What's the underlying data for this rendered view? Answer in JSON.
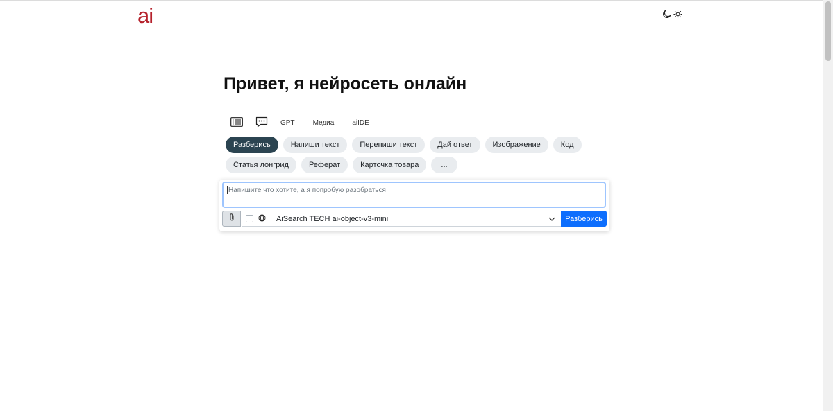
{
  "header": {
    "logo_text": "ai",
    "logo_color": "#b5212b",
    "theme_icons": [
      "moon-icon",
      "sun-icon"
    ]
  },
  "main": {
    "title": "Привет, я нейросеть онлайн",
    "mode_tabs": [
      {
        "icon": "list-icon"
      },
      {
        "icon": "chat-bubble-icon"
      },
      {
        "label": "GPT"
      },
      {
        "label": "Медиа"
      },
      {
        "label": "aiIDE"
      }
    ],
    "prompt_chips": [
      {
        "label": "Разберись",
        "active": true
      },
      {
        "label": "Напиши текст"
      },
      {
        "label": "Перепиши текст"
      },
      {
        "label": "Дай ответ"
      },
      {
        "label": "Изображение"
      },
      {
        "label": "Код"
      },
      {
        "label": "Статья лонгрид"
      },
      {
        "label": "Реферат"
      },
      {
        "label": "Карточка товара"
      },
      {
        "label": "..."
      }
    ],
    "composer": {
      "placeholder": "Напишите что хотите, а я попробую разобраться",
      "value": "",
      "attach_icon": "paperclip-icon",
      "web_search_icon": "globe-icon",
      "web_search_checked": false,
      "model": "AiSearch TECH ai-object-v3-mini",
      "submit_label": "Разберись",
      "accent_color": "#0d6efd"
    }
  }
}
